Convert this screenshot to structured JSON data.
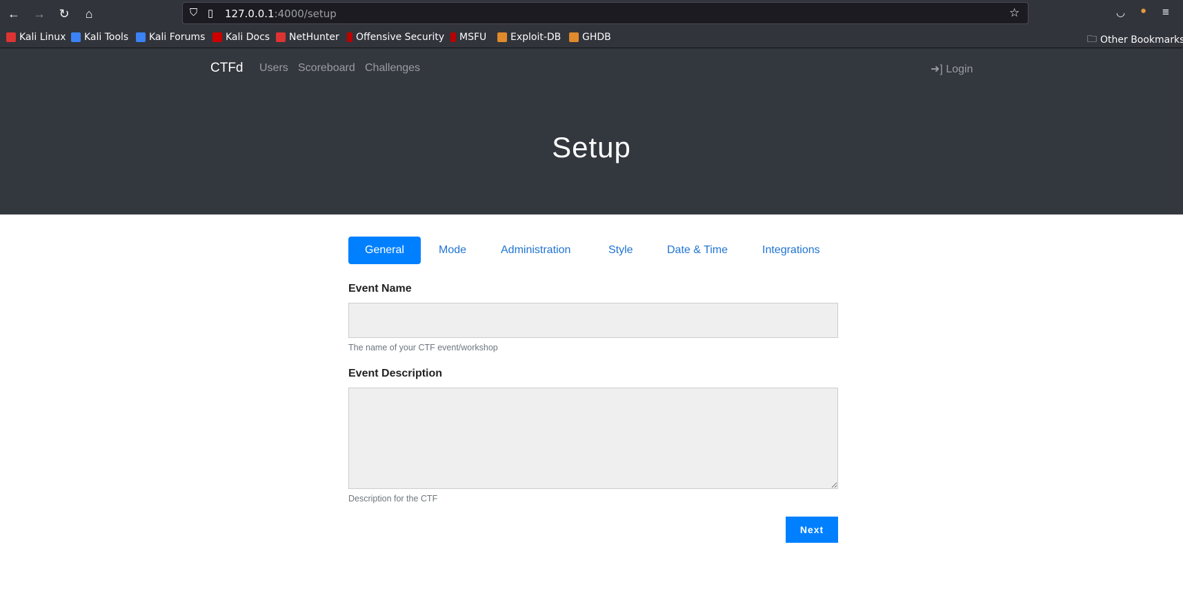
{
  "browser": {
    "url_host": "127.0.0.1",
    "url_rest": ":4000/setup",
    "bookmarks": [
      "Kali Linux",
      "Kali Tools",
      "Kali Forums",
      "Kali Docs",
      "NetHunter",
      "Offensive Security",
      "MSFU",
      "Exploit-DB",
      "GHDB"
    ],
    "other_bookmarks": "Other Bookmarks"
  },
  "navbar": {
    "brand": "CTFd",
    "links": [
      "Users",
      "Scoreboard",
      "Challenges"
    ],
    "login": "Login"
  },
  "page": {
    "title": "Setup"
  },
  "tabs": [
    "General",
    "Mode",
    "Administration",
    "Style",
    "Date & Time",
    "Integrations"
  ],
  "form": {
    "event_name_label": "Event Name",
    "event_name_value": "",
    "event_name_help": "The name of your CTF event/workshop",
    "event_desc_label": "Event Description",
    "event_desc_value": "",
    "event_desc_help": "Description for the CTF",
    "next": "Next"
  },
  "colors": {
    "primary": "#0080ff",
    "navbar": "#33373e"
  }
}
